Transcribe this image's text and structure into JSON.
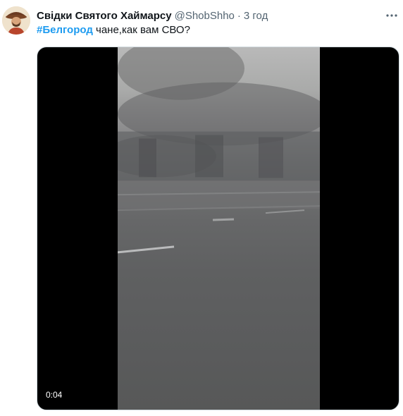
{
  "author": {
    "display_name": "Свідки Святого Хаймарсу",
    "handle": "@ShobShho",
    "separator": "·",
    "time": "3 год"
  },
  "tweet": {
    "hashtag": "#Белгород",
    "text": " чане,как вам СВО?"
  },
  "video": {
    "duration": "0:04"
  },
  "icons": {
    "more": "more-horizontal-icon",
    "avatar": "avatar-image"
  },
  "colors": {
    "accent": "#1d9bf0",
    "text_primary": "#0f1419",
    "text_secondary": "#536471"
  }
}
